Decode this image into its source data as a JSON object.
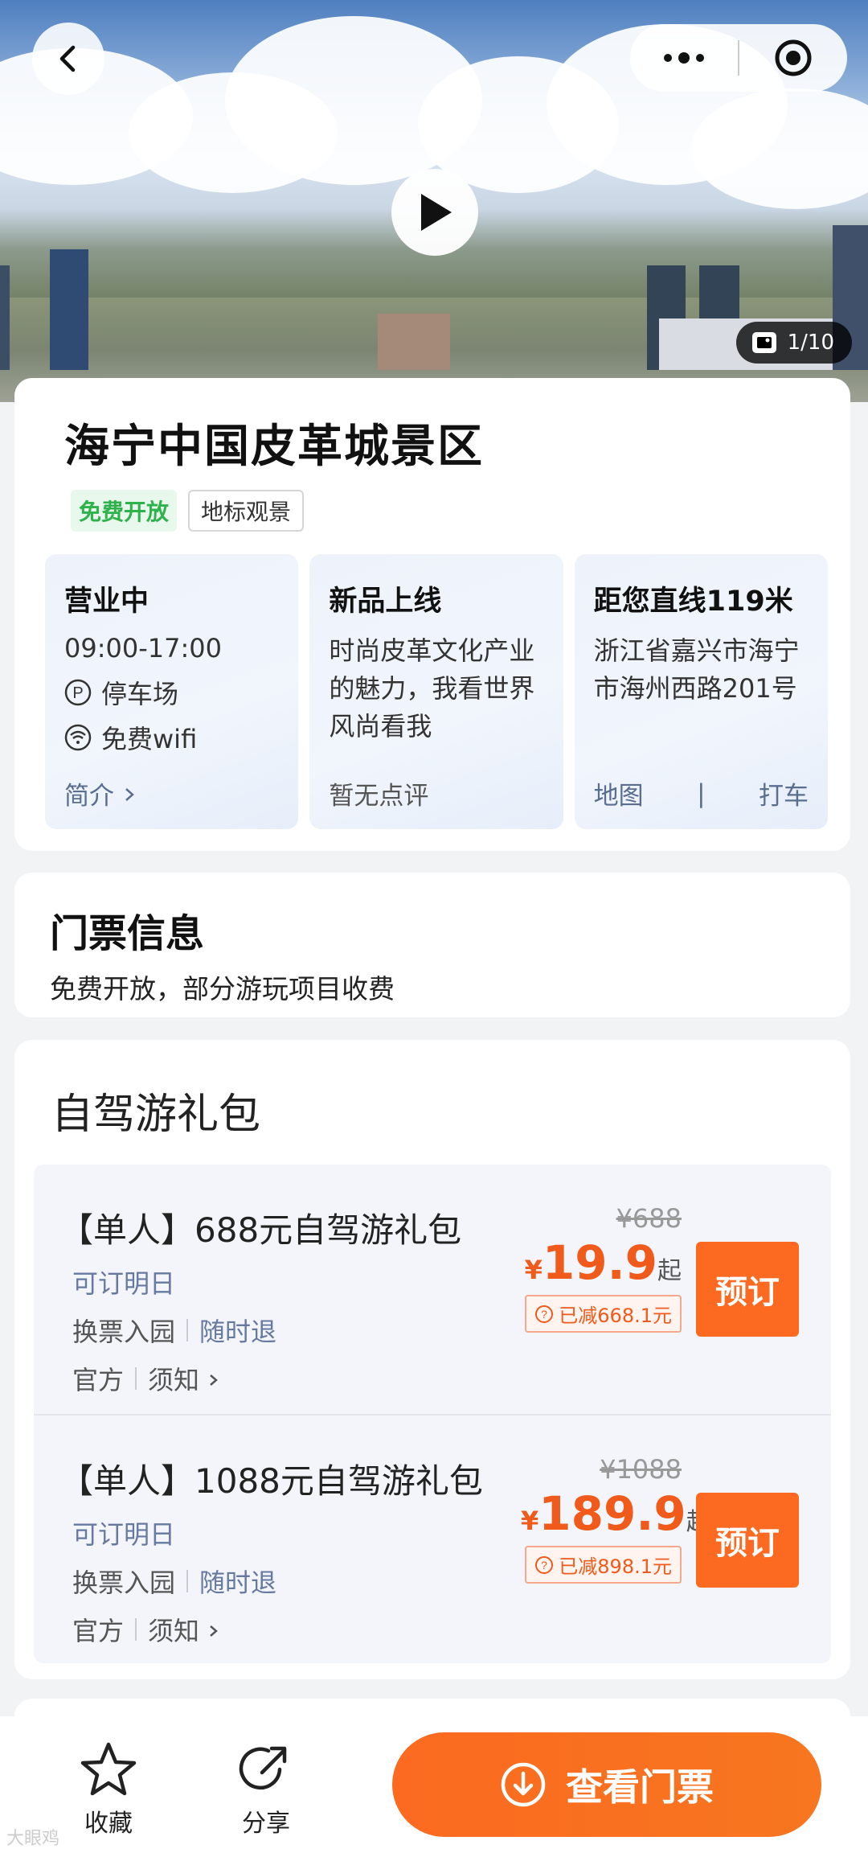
{
  "hero": {
    "photo_count": "1/10"
  },
  "attraction": {
    "title": "海宁中国皮革城景区",
    "tags": {
      "free": "免费开放",
      "landmark": "地标观景"
    }
  },
  "features": {
    "hours": {
      "title": "营业中",
      "time": "09:00-17:00",
      "parking": "停车场",
      "wifi": "免费wifi",
      "intro_link": "简介"
    },
    "news": {
      "title": "新品上线",
      "desc": "时尚皮革文化产业的魅力，我看世界风尚看我",
      "reviews": "暂无点评"
    },
    "location": {
      "title": "距您直线119米",
      "address": "浙江省嘉兴市海宁市海州西路201号",
      "map_link": "地图",
      "taxi_link": "打车"
    }
  },
  "ticket_info": {
    "title": "门票信息",
    "subtitle": "免费开放，部分游玩项目收费"
  },
  "packages": {
    "title": "自驾游礼包",
    "items": [
      {
        "name": "【单人】688元自驾游礼包",
        "availability": "可订明日",
        "feature1": "换票入园",
        "feature2": "随时退",
        "source": "官方",
        "notice": "须知",
        "original_price": "¥688",
        "yen": "¥",
        "price": "19.9",
        "suffix": "起",
        "discount": "已减668.1元",
        "book_label": "预订"
      },
      {
        "name": "【单人】1088元自驾游礼包",
        "availability": "可订明日",
        "feature1": "换票入园",
        "feature2": "随时退",
        "source": "官方",
        "notice": "须知",
        "original_price": "¥1088",
        "yen": "¥",
        "price": "189.9",
        "suffix": "起",
        "discount": "已减898.1元",
        "book_label": "预订"
      }
    ]
  },
  "bottom_bar": {
    "favorite": "收藏",
    "share": "分享",
    "cta": "查看门票"
  },
  "watermark": "大眼鸡",
  "colors": {
    "accent": "#fb6a20",
    "green_tag": "#2fb24b",
    "link": "#6679a0"
  }
}
